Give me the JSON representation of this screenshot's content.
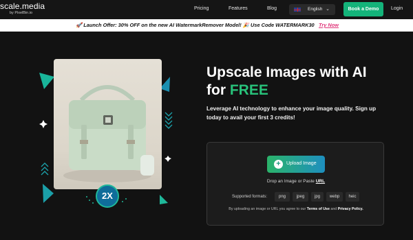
{
  "header": {
    "logo_main": "scale.media",
    "logo_sub": "by PixelBin.io",
    "nav": [
      "Pricing",
      "Features",
      "Blog"
    ],
    "language": "English",
    "demo_button": "Book a Demo",
    "login": "Login"
  },
  "banner": {
    "text": "Launch Offer: 30% OFF on the new AI WatermarkRemover Model! 🎉 Use Code WATERMARK30",
    "link": "Try Now"
  },
  "hero": {
    "title_line1": "Upscale Images with AI",
    "title_for": "for ",
    "title_free": "FREE",
    "subtitle": "Leverage AI technology to enhance your image quality. Sign up today to avail your first 3 credits!",
    "badge": "2X"
  },
  "upload": {
    "button": "Upload Image",
    "drop_text": "Drop an Image or Paste ",
    "drop_url": "URL",
    "formats_label": "Supported formats:",
    "formats": [
      "png",
      "jpeg",
      "jpg",
      "webp",
      "heic"
    ],
    "terms_prefix": "By uploading an image or URL you agree to our ",
    "terms_link": "Terms of Use",
    "terms_and": " and ",
    "privacy_link": "Privacy Policy."
  },
  "colors": {
    "accent_green": "#14b37a",
    "free_green": "#28c27a",
    "promo_link": "#e0367a",
    "background": "#121212"
  },
  "icons": [
    "rocket-icon",
    "party-icon",
    "flag-uk-icon",
    "chevron-down-icon",
    "plus-circle-icon",
    "sparkle-icon"
  ]
}
